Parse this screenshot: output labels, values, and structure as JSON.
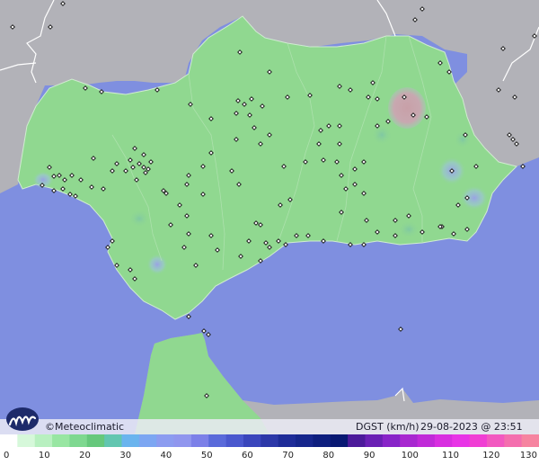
{
  "brand": {
    "name": "Meteoclimatic",
    "copyright_symbol": "©"
  },
  "variable": "DGST (km/h)",
  "timestamp": "29-08-2023 @ 23:51 UTC",
  "colors": {
    "sea": "#7f8fe0",
    "land_outside": "#b2b2b8",
    "region_low_wind": "#90d890",
    "gust_hotspot": "#9aa0e8",
    "calm_spot": "#c8a8b0",
    "border_line": "#ffffff"
  },
  "legend": {
    "min": 0,
    "max": 130,
    "tick_labels": [
      "0",
      "10",
      "20",
      "30",
      "40",
      "50",
      "60",
      "70",
      "80",
      "90",
      "100",
      "110",
      "120",
      "130"
    ],
    "color_steps": [
      "#ffffff",
      "#d6f8da",
      "#b8f0c0",
      "#98e6a2",
      "#7ed890",
      "#66c87c",
      "#62c6b0",
      "#6ab4ee",
      "#7ca6f2",
      "#8c9cf0",
      "#9096ee",
      "#7c80e8",
      "#5a6ada",
      "#4a58ce",
      "#3a46bc",
      "#2c38a8",
      "#1e2c98",
      "#16268c",
      "#0e1e7e",
      "#081872",
      "#4c1a9a",
      "#6a20b4",
      "#8824c8",
      "#a828d0",
      "#c02ad8",
      "#d82ee0",
      "#e834e6",
      "#f03ed4",
      "#f258c0",
      "#f46eae",
      "#f684a0"
    ]
  },
  "stations": [
    [
      14,
      30
    ],
    [
      56,
      30
    ],
    [
      70,
      4
    ],
    [
      95,
      98
    ],
    [
      113,
      102
    ],
    [
      175,
      100
    ],
    [
      212,
      116
    ],
    [
      235,
      132
    ],
    [
      267,
      58
    ],
    [
      280,
      110
    ],
    [
      263,
      126
    ],
    [
      278,
      128
    ],
    [
      272,
      116
    ],
    [
      292,
      118
    ],
    [
      265,
      112
    ],
    [
      283,
      142
    ],
    [
      300,
      150
    ],
    [
      290,
      160
    ],
    [
      263,
      155
    ],
    [
      235,
      170
    ],
    [
      226,
      185
    ],
    [
      210,
      195
    ],
    [
      185,
      215
    ],
    [
      200,
      228
    ],
    [
      190,
      250
    ],
    [
      210,
      260
    ],
    [
      205,
      275
    ],
    [
      218,
      295
    ],
    [
      235,
      262
    ],
    [
      242,
      278
    ],
    [
      268,
      285
    ],
    [
      290,
      290
    ],
    [
      296,
      270
    ],
    [
      310,
      268
    ],
    [
      318,
      272
    ],
    [
      330,
      262
    ],
    [
      343,
      262
    ],
    [
      360,
      268
    ],
    [
      390,
      272
    ],
    [
      405,
      272
    ],
    [
      420,
      258
    ],
    [
      440,
      262
    ],
    [
      470,
      258
    ],
    [
      492,
      252
    ],
    [
      505,
      260
    ],
    [
      520,
      255
    ],
    [
      510,
      228
    ],
    [
      520,
      220
    ],
    [
      530,
      185
    ],
    [
      518,
      150
    ],
    [
      503,
      190
    ],
    [
      490,
      252
    ],
    [
      455,
      240
    ],
    [
      440,
      245
    ],
    [
      408,
      245
    ],
    [
      380,
      236
    ],
    [
      385,
      210
    ],
    [
      395,
      205
    ],
    [
      405,
      215
    ],
    [
      380,
      195
    ],
    [
      375,
      180
    ],
    [
      360,
      178
    ],
    [
      378,
      160
    ],
    [
      378,
      140
    ],
    [
      366,
      140
    ],
    [
      357,
      145
    ],
    [
      355,
      160
    ],
    [
      340,
      180
    ],
    [
      323,
      222
    ],
    [
      312,
      228
    ],
    [
      290,
      250
    ],
    [
      285,
      248
    ],
    [
      277,
      268
    ],
    [
      300,
      275
    ],
    [
      266,
      205
    ],
    [
      258,
      190
    ],
    [
      226,
      216
    ],
    [
      208,
      205
    ],
    [
      208,
      240
    ],
    [
      182,
      212
    ],
    [
      165,
      188
    ],
    [
      160,
      186
    ],
    [
      155,
      182
    ],
    [
      148,
      186
    ],
    [
      140,
      190
    ],
    [
      145,
      178
    ],
    [
      125,
      190
    ],
    [
      115,
      210
    ],
    [
      102,
      208
    ],
    [
      90,
      200
    ],
    [
      80,
      195
    ],
    [
      72,
      200
    ],
    [
      66,
      195
    ],
    [
      70,
      210
    ],
    [
      78,
      216
    ],
    [
      84,
      218
    ],
    [
      60,
      212
    ],
    [
      47,
      206
    ],
    [
      60,
      196
    ],
    [
      55,
      186
    ],
    [
      104,
      176
    ],
    [
      150,
      165
    ],
    [
      160,
      172
    ],
    [
      168,
      180
    ],
    [
      152,
      200
    ],
    [
      162,
      192
    ],
    [
      130,
      182
    ],
    [
      125,
      268
    ],
    [
      120,
      275
    ],
    [
      130,
      295
    ],
    [
      145,
      300
    ],
    [
      150,
      310
    ],
    [
      210,
      352
    ],
    [
      227,
      368
    ],
    [
      232,
      372
    ],
    [
      230,
      440
    ],
    [
      470,
      10
    ],
    [
      462,
      22
    ],
    [
      490,
      70
    ],
    [
      500,
      80
    ],
    [
      555,
      100
    ],
    [
      573,
      108
    ],
    [
      567,
      150
    ],
    [
      571,
      155
    ],
    [
      575,
      160
    ],
    [
      582,
      185
    ],
    [
      560,
      54
    ],
    [
      595,
      40
    ],
    [
      415,
      92
    ],
    [
      420,
      110
    ],
    [
      410,
      108
    ],
    [
      390,
      100
    ],
    [
      378,
      96
    ],
    [
      345,
      106
    ],
    [
      320,
      108
    ],
    [
      432,
      135
    ],
    [
      420,
      140
    ],
    [
      405,
      180
    ],
    [
      395,
      188
    ],
    [
      450,
      108
    ],
    [
      460,
      128
    ],
    [
      475,
      130
    ],
    [
      300,
      80
    ],
    [
      316,
      185
    ],
    [
      446,
      366
    ]
  ]
}
